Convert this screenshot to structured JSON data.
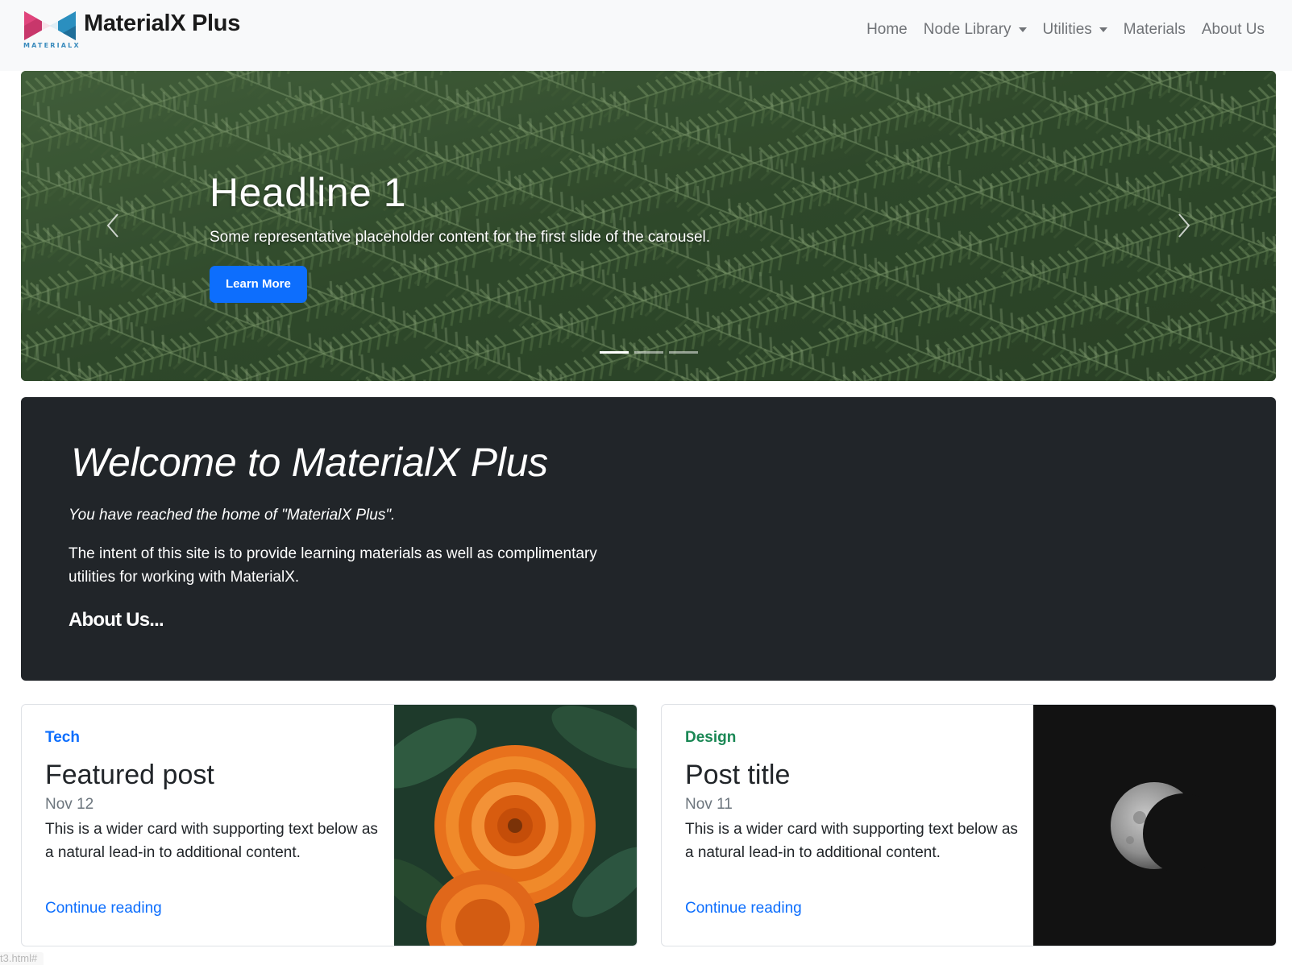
{
  "brand": {
    "logo_word": "MATERIALX",
    "title": "MaterialX Plus"
  },
  "nav": {
    "items": [
      {
        "label": "Home",
        "dropdown": false
      },
      {
        "label": "Node Library",
        "dropdown": true
      },
      {
        "label": "Utilities",
        "dropdown": true
      },
      {
        "label": "Materials",
        "dropdown": false
      },
      {
        "label": "About Us",
        "dropdown": false
      }
    ]
  },
  "carousel": {
    "headline": "Headline 1",
    "text": "Some representative placeholder content for the first slide of the carousel.",
    "button": "Learn More",
    "slide_count": 3,
    "active_slide": 1
  },
  "jumbotron": {
    "title": "Welcome to MaterialX Plus",
    "subtitle": "You have reached the home of \"MaterialX Plus\".",
    "text": "The intent of this site is to provide learning materials as well as complimentary utilities for working with MaterialX.",
    "about": "About Us..."
  },
  "cards": [
    {
      "category": "Tech",
      "category_color": "#0d6efd",
      "title": "Featured post",
      "date": "Nov 12",
      "text": "This is a wider card with supporting text below as a natural lead-in to additional content.",
      "link": "Continue reading",
      "image": "orange-flower-image"
    },
    {
      "category": "Design",
      "category_color": "#198754",
      "title": "Post title",
      "date": "Nov 11",
      "text": "This is a wider card with supporting text below as a natural lead-in to additional content.",
      "link": "Continue reading",
      "image": "moon-image"
    }
  ],
  "status_bar": {
    "url": "t3.html#"
  },
  "colors": {
    "navbar_bg": "#f8f9fa",
    "primary": "#0d6efd",
    "dark": "#212529"
  }
}
